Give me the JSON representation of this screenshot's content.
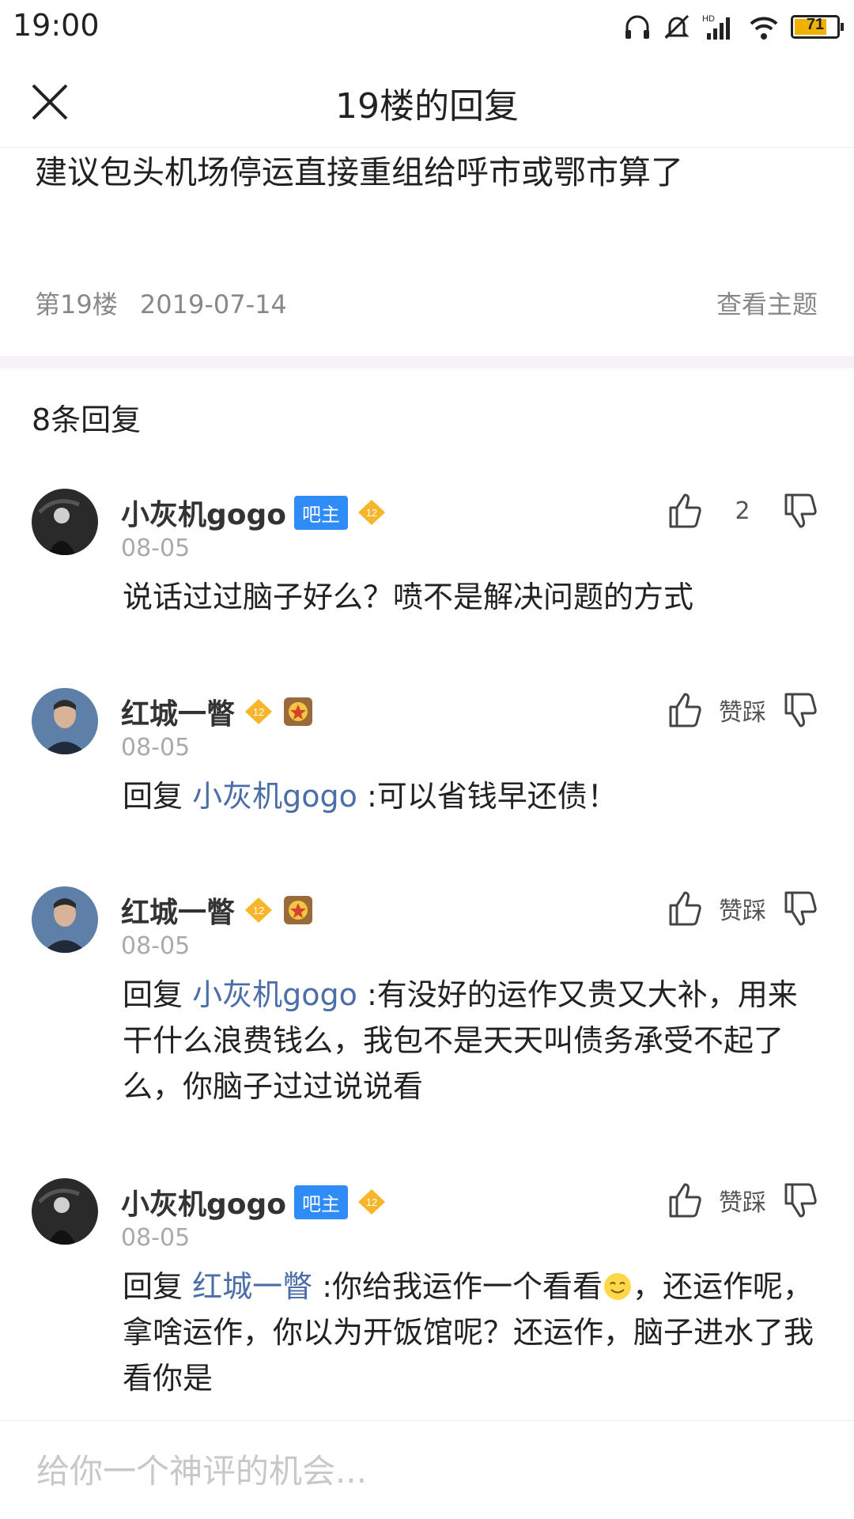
{
  "status": {
    "time": "19:00",
    "battery": "71",
    "network": "HD"
  },
  "header": {
    "title": "19楼的回复"
  },
  "post": {
    "text": "建议包头机场停运直接重组给呼市或鄂市算了",
    "floor": "第19楼",
    "date": "2019-07-14",
    "view_topic": "查看主题"
  },
  "reply_count": "8条回复",
  "labels": {
    "owner_badge": "吧主",
    "level": "12",
    "reply_prefix": "回复",
    "like_dislike": "赞踩"
  },
  "replies": [
    {
      "user": "小灰机gogo",
      "date": "08-05",
      "likes": "2",
      "text": "说话过过脑子好么？喷不是解决问题的方式"
    },
    {
      "user": "红城一瞥",
      "date": "08-05",
      "mention": "小灰机gogo",
      "text": " :可以省钱早还债！"
    },
    {
      "user": "红城一瞥",
      "date": "08-05",
      "mention": "小灰机gogo",
      "text": " :有没好的运作又贵又大补，用来干什么浪费钱么，我包不是天天叫债务承受不起了么，你脑子过过说说看"
    },
    {
      "user": "小灰机gogo",
      "date": "08-05",
      "mention": "红城一瞥",
      "text_a": " :你给我运作一个看看",
      "text_b": "，还运作呢，拿啥运作，你以为开饭馆呢？还运作，脑子进水了我看你是"
    }
  ],
  "comment": {
    "placeholder": "给你一个神评的机会..."
  }
}
